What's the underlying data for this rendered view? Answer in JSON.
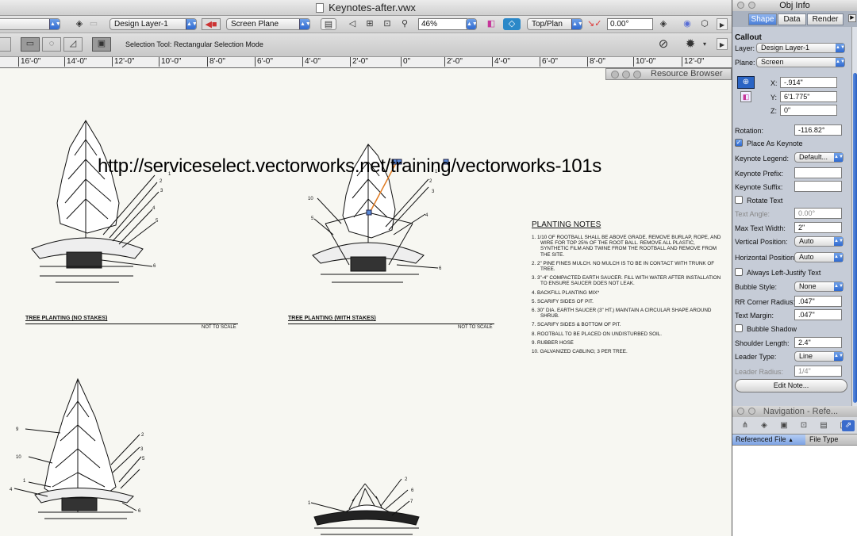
{
  "window": {
    "title": "Keynotes-after.vwx"
  },
  "toolbar": {
    "class_popup": "",
    "layer_popup": "Design Layer-1",
    "plane_popup": "Screen Plane",
    "zoom_value": "46%",
    "view_popup": "Top/Plan",
    "rotation_value": "0.00°",
    "mode_label": "Selection Tool: Rectangular Selection Mode"
  },
  "ruler": {
    "ticks": [
      "16'-0\"",
      "14'-0\"",
      "12'-0\"",
      "10'-0\"",
      "8'-0\"",
      "6'-0\"",
      "4'-0\"",
      "2'-0\"",
      "0\"",
      "2'-0\"",
      "4'-0\"",
      "6'-0\"",
      "8'-0\"",
      "10'-0\"",
      "12'-0\""
    ]
  },
  "resource_browser": {
    "title": "Resource Browser"
  },
  "drawing": {
    "url_text": "http://serviceselect.vectorworks.net/training/vectorworks-101s",
    "planting_notes_title": "PLANTING NOTES",
    "planting_notes": [
      "1.  1/10 of rootball shall be above grade. Remove burlap, rope, and wire for top 25% of the root ball. Remove all plastic, synthetic film and twine from the rootball and remove from the site.",
      "2.  2\" pine fines mulch. No mulch is to be in contact with trunk of tree.",
      "3.  3\"-4\" compacted earth saucer. Fill with water after installation to ensure saucer does not leak.",
      "4.  Backfill planting mix*",
      "5.  Scarify sides of pit.",
      "6.  30\" dia. earth saucer (3\" ht.) Maintain a circular shape around shrub.",
      "7.  Scarify sides & bottom of pit.",
      "8.  Rootball to be placed on undisturbed soil.",
      "9.  Rubber hose",
      "10. Galvanized cabling; 3 per tree."
    ],
    "caption_left": "TREE PLANTING (NO STAKES)",
    "caption_right": "TREE PLANTING (WITH STAKES)",
    "not_to_scale": "NOT TO SCALE",
    "callout_numbers_left": [
      "1",
      "2",
      "3",
      "4",
      "5",
      "6"
    ],
    "callout_numbers_right": [
      "1",
      "2",
      "3",
      "4",
      "5",
      "6",
      "10"
    ],
    "callout_numbers_bottom_left": [
      "1",
      "2",
      "3",
      "4",
      "5",
      "6",
      "9",
      "10"
    ],
    "callout_numbers_bottom_right": [
      "1",
      "2",
      "6",
      "7"
    ]
  },
  "obj_info": {
    "title": "Obj Info",
    "tabs": [
      "Shape",
      "Data",
      "Render"
    ],
    "object_type": "Callout",
    "layer_label": "Layer:",
    "layer_value": "Design Layer-1",
    "plane_label": "Plane:",
    "plane_value": "Screen",
    "x_label": "X:",
    "x_value": "-.914\"",
    "y_label": "Y:",
    "y_value": "6'1.775\"",
    "z_label": "Z:",
    "z_value": "0\"",
    "rotation_label": "Rotation:",
    "rotation_value": "-116.82°",
    "place_as_keynote": "Place As Keynote",
    "keynote_legend_label": "Keynote Legend:",
    "keynote_legend_value": "Default...",
    "keynote_prefix_label": "Keynote Prefix:",
    "keynote_prefix_value": "",
    "keynote_suffix_label": "Keynote Suffix:",
    "keynote_suffix_value": "",
    "rotate_text": "Rotate Text",
    "text_angle_label": "Text Angle:",
    "text_angle_value": "0.00°",
    "max_text_width_label": "Max Text Width:",
    "max_text_width_value": "2\"",
    "vertical_position_label": "Vertical Position:",
    "vertical_position_value": "Auto",
    "horizontal_position_label": "Horizontal Position:",
    "horizontal_position_value": "Auto",
    "always_left_justify": "Always Left-Justify Text",
    "bubble_style_label": "Bubble Style:",
    "bubble_style_value": "None",
    "rr_corner_radius_label": "RR Corner Radius:",
    "rr_corner_radius_value": ".047\"",
    "text_margin_label": "Text Margin:",
    "text_margin_value": ".047\"",
    "bubble_shadow": "Bubble Shadow",
    "shoulder_length_label": "Shoulder Length:",
    "shoulder_length_value": "2.4\"",
    "leader_type_label": "Leader Type:",
    "leader_type_value": "Line",
    "leader_radius_label": "Leader Radius:",
    "leader_radius_value": "1/4\"",
    "edit_note_button": "Edit Note..."
  },
  "navigation": {
    "title": "Navigation - Refe...",
    "col_referenced_file": "Referenced File",
    "col_file_type": "File Type"
  }
}
